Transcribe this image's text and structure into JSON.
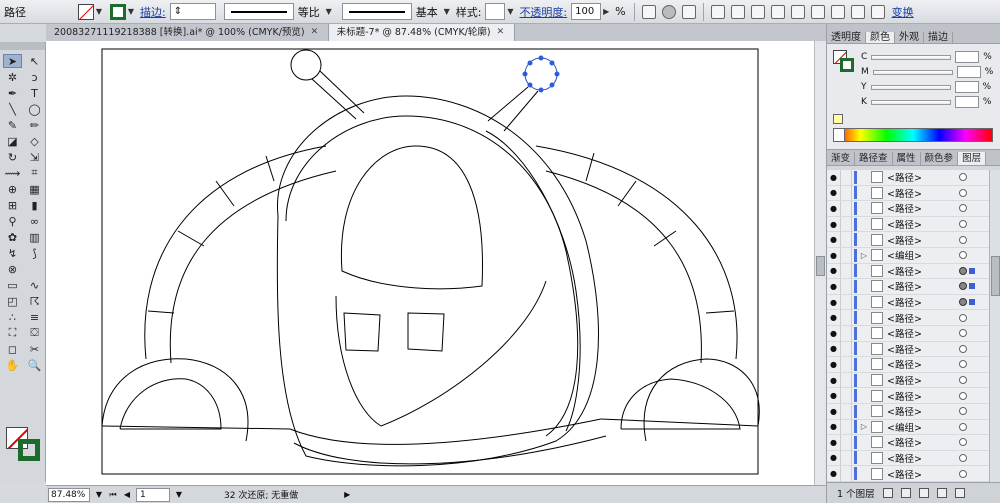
{
  "control_bar": {
    "object_label": "路径",
    "stroke_link": "描边:",
    "stroke_ratio": "等比",
    "brush_label": "基本",
    "style_label": "样式:",
    "opacity_link": "不透明度:",
    "opacity_value": "100",
    "opacity_unit": "%",
    "transform_link": "变换"
  },
  "tabs": [
    {
      "label": "20083271119218388 [转换].ai* @ 100% (CMYK/预览)"
    },
    {
      "label": "未标题-7* @ 87.48% (CMYK/轮廓)"
    }
  ],
  "status_bar": {
    "zoom": "87.48%",
    "page": "1",
    "message": "32 次还原; 无重做"
  },
  "color_panel": {
    "tabs": [
      "透明度",
      "颜色",
      "外观",
      "描边"
    ],
    "channels": [
      "C",
      "M",
      "Y",
      "K"
    ],
    "pct": "%",
    "accent_stroke": "#1d6b2c",
    "accent_none": "#dd0000"
  },
  "layers_panel": {
    "tabs": [
      "渐变",
      "路径查",
      "属性",
      "颜色参",
      "图层"
    ],
    "footer_label": "1 个图层",
    "rows": [
      {
        "label": "<路径>",
        "group": false,
        "active": false
      },
      {
        "label": "<路径>",
        "group": false,
        "active": false
      },
      {
        "label": "<路径>",
        "group": false,
        "active": false
      },
      {
        "label": "<路径>",
        "group": false,
        "active": false
      },
      {
        "label": "<路径>",
        "group": false,
        "active": false
      },
      {
        "label": "<编组>",
        "group": true,
        "active": false
      },
      {
        "label": "<路径>",
        "group": false,
        "active": true
      },
      {
        "label": "<路径>",
        "group": false,
        "active": true
      },
      {
        "label": "<路径>",
        "group": false,
        "active": true
      },
      {
        "label": "<路径>",
        "group": false,
        "active": false
      },
      {
        "label": "<路径>",
        "group": false,
        "active": false
      },
      {
        "label": "<路径>",
        "group": false,
        "active": false
      },
      {
        "label": "<路径>",
        "group": false,
        "active": false
      },
      {
        "label": "<路径>",
        "group": false,
        "active": false
      },
      {
        "label": "<路径>",
        "group": false,
        "active": false
      },
      {
        "label": "<路径>",
        "group": false,
        "active": false
      },
      {
        "label": "<编组>",
        "group": true,
        "active": false
      },
      {
        "label": "<路径>",
        "group": false,
        "active": false
      },
      {
        "label": "<路径>",
        "group": false,
        "active": false
      },
      {
        "label": "<路径>",
        "group": false,
        "active": false
      }
    ]
  }
}
